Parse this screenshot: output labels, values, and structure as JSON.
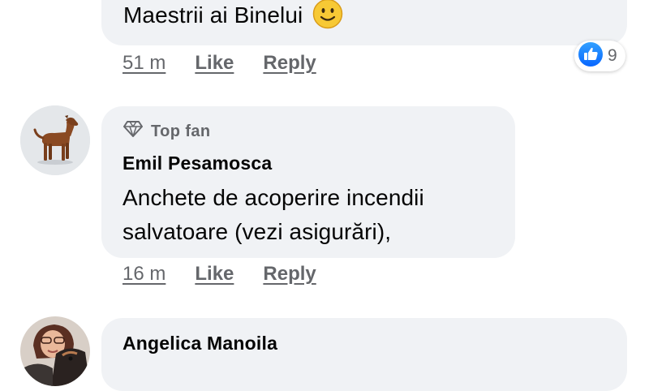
{
  "comments": [
    {
      "text": "Maestrii ai Binelui",
      "emoji": "slightly-smiling-face-icon",
      "time": "51 m",
      "like_label": "Like",
      "reply_label": "Reply",
      "reaction": {
        "icon": "like-icon",
        "count": "9"
      }
    },
    {
      "badge": "Top fan",
      "badge_icon": "diamond-icon",
      "author": "Emil Pesamosca",
      "text_lines": [
        "Anchete de acoperire incendii",
        "salvatoare (vezi asigurări),"
      ],
      "time": "16 m",
      "like_label": "Like",
      "reply_label": "Reply",
      "avatar": "dog-avatar"
    },
    {
      "author": "Angelica Manoila",
      "avatar": "woman-with-dog-avatar"
    }
  ],
  "colors": {
    "bubble": "#f0f2f5",
    "meta_text": "#65676b",
    "like_blue": "#1877f2",
    "emoji_yellow": "#f7c935"
  }
}
